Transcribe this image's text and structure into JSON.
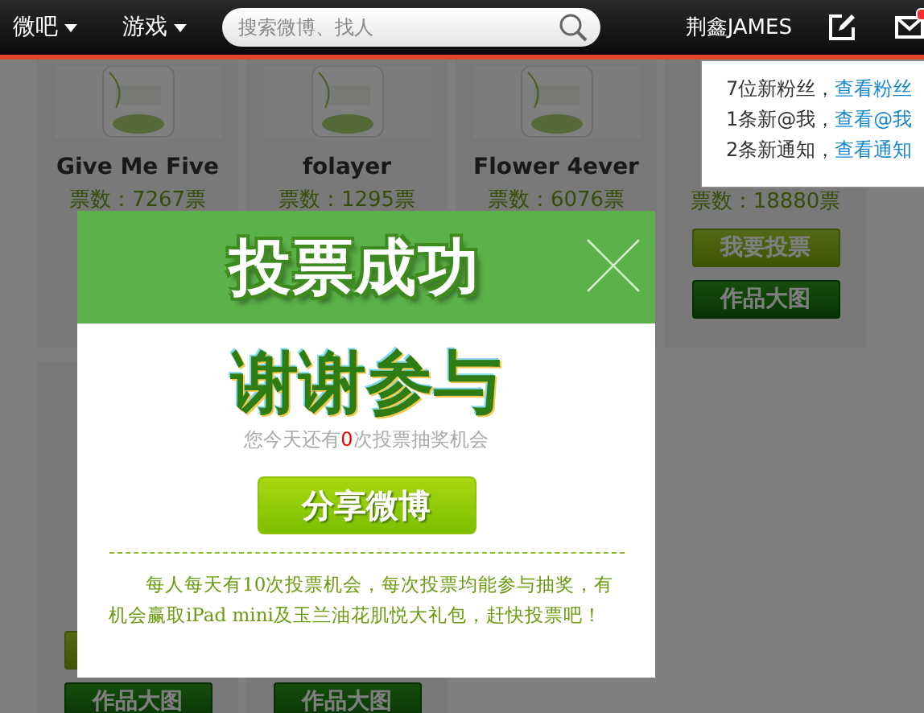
{
  "topbar": {
    "menus": [
      {
        "label": "微吧"
      },
      {
        "label": "游戏"
      }
    ],
    "search": {
      "placeholder": "搜索微博、找人"
    },
    "user": "荆鑫JAMES",
    "mail_unread": true
  },
  "notifications": [
    {
      "text": "7位新粉丝，",
      "link": "查看粉丝"
    },
    {
      "text": "1条新@我，",
      "link": "查看@我"
    },
    {
      "text": "2条新通知，",
      "link": "查看通知"
    }
  ],
  "rows": [
    {
      "cards": [
        {
          "kind": "picture",
          "name": "Give Me Five",
          "votes": "票数：7267票"
        },
        {
          "kind": "picture",
          "name": "folayer",
          "votes": "票数：1295票"
        },
        {
          "kind": "picture",
          "name": "Flower 4ever",
          "votes": "票数：6076票"
        },
        {
          "kind": "plain",
          "votes": "票数：18880票",
          "buttons": [
            {
              "label": "我要投票",
              "kind": "vote"
            },
            {
              "label": "作品大图",
              "kind": "view"
            }
          ]
        }
      ]
    },
    {
      "cards": [
        {
          "kind": "plain",
          "buttons": [
            {
              "kind": "vote"
            },
            {
              "label": "作品大图",
              "kind": "view"
            }
          ]
        },
        {
          "kind": "plain",
          "buttons": [
            {
              "label": "作品大图",
              "kind": "view"
            }
          ]
        }
      ]
    }
  ],
  "dialog": {
    "title": "投票成功",
    "heading": "谢谢参与",
    "chances": {
      "before": "您今天还有",
      "count": "0",
      "after": "次投票抽奖机会"
    },
    "share_button": "分享微博",
    "note": "每人每天有10次投票机会，每次投票均能参与抽奖，有机会赢取iPad mini及玉兰油花肌悦大礼包，赶快投票吧！"
  }
}
